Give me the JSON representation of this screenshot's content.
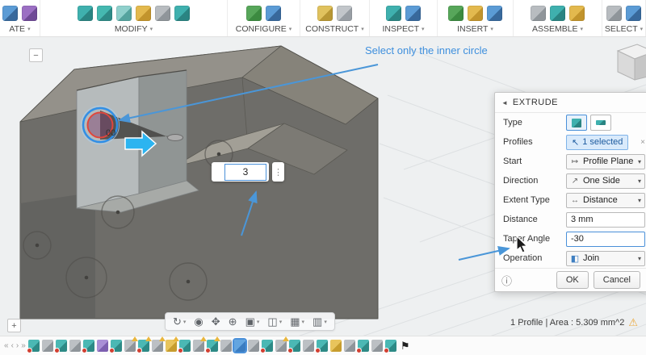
{
  "colors": {
    "accent": "#4a90d9",
    "annotation_blue": "#3e8fdd",
    "selection_blue_ring": "#2f8fe8",
    "selection_red_ring": "#e0463c",
    "warning_yellow": "#eba73a",
    "timeline_error_red": "#d23f31"
  },
  "toolbar": {
    "chevron": "▾",
    "groups": [
      {
        "id": "create",
        "label": "ATE",
        "icons": [
          {
            "name": "create-sketch-icon",
            "c1": "#5b9bd5",
            "c2": "#38699c"
          },
          {
            "name": "create-form-icon",
            "c1": "#9b6fc3",
            "c2": "#6f4a96"
          }
        ]
      },
      {
        "id": "modify",
        "label": "MODIFY",
        "icons": [
          {
            "name": "press-pull-icon",
            "c1": "#3fb0ae",
            "c2": "#2a8482"
          },
          {
            "name": "fillet-icon",
            "c1": "#45b8b0",
            "c2": "#2d8a86"
          },
          {
            "name": "shell-icon",
            "c1": "#8fd0cc",
            "c2": "#54a39e"
          },
          {
            "name": "combine-icon",
            "c1": "#e3b94e",
            "c2": "#c2942c"
          },
          {
            "name": "offset-face-icon",
            "c1": "#b8bcc0",
            "c2": "#8f959a"
          },
          {
            "name": "split-body-icon",
            "c1": "#3fb0ae",
            "c2": "#2a8482"
          }
        ]
      },
      {
        "id": "configure",
        "label": "CONFIGURE",
        "icons": [
          {
            "name": "configuration-table-icon",
            "c1": "#57a65a",
            "c2": "#3c8a40"
          },
          {
            "name": "variants-icon",
            "c1": "#5b9bd5",
            "c2": "#38699c"
          }
        ]
      },
      {
        "id": "construct",
        "label": "CONSTRUCT",
        "icons": [
          {
            "name": "offset-plane-icon",
            "c1": "#e0c25e",
            "c2": "#b89734"
          },
          {
            "name": "construction-axis-icon",
            "c1": "#c2c6ca",
            "c2": "#989ea4"
          }
        ]
      },
      {
        "id": "inspect",
        "label": "INSPECT",
        "icons": [
          {
            "name": "measure-icon",
            "c1": "#3fb0ae",
            "c2": "#2a8482"
          },
          {
            "name": "section-analysis-icon",
            "c1": "#5b9bd5",
            "c2": "#38699c"
          }
        ]
      },
      {
        "id": "insert",
        "label": "INSERT",
        "icons": [
          {
            "name": "insert-canvas-icon",
            "c1": "#57a65a",
            "c2": "#3c8a40"
          },
          {
            "name": "insert-mesh-icon",
            "c1": "#e3b94e",
            "c2": "#c2942c"
          },
          {
            "name": "insert-decal-icon",
            "c1": "#5b9bd5",
            "c2": "#38699c"
          }
        ]
      },
      {
        "id": "assemble",
        "label": "ASSEMBLE",
        "icons": [
          {
            "name": "new-component-icon",
            "c1": "#b8bcc0",
            "c2": "#8f959a"
          },
          {
            "name": "joint-icon",
            "c1": "#3fb0ae",
            "c2": "#2a8482"
          },
          {
            "name": "rigid-group-icon",
            "c1": "#e3b94e",
            "c2": "#c2942c"
          }
        ]
      },
      {
        "id": "select",
        "label": "SELECT",
        "icons": [
          {
            "name": "select-tool-icon",
            "c1": "#b8bcc0",
            "c2": "#8f959a"
          },
          {
            "name": "select-window-icon",
            "c1": "#5b9bd5",
            "c2": "#38699c"
          }
        ]
      }
    ]
  },
  "canvas": {
    "annotation": "Select only the inner circle",
    "dim_fragment": "00",
    "floating_input": {
      "value": "3",
      "grip": "⋮"
    },
    "collapse_button": "−",
    "add_button": "+"
  },
  "extrude_panel": {
    "collapse_icon": "◄",
    "title": "EXTRUDE",
    "rows": {
      "type": {
        "label": "Type"
      },
      "profiles": {
        "label": "Profiles",
        "cursor": "↖",
        "value": "1 selected",
        "clear": "×"
      },
      "start": {
        "label": "Start",
        "icon": "↦",
        "value": "Profile Plane",
        "chevron": "▾"
      },
      "direction": {
        "label": "Direction",
        "icon": "↗",
        "value": "One Side",
        "chevron": "▾"
      },
      "extent": {
        "label": "Extent Type",
        "icon": "↔",
        "value": "Distance",
        "chevron": "▾"
      },
      "distance": {
        "label": "Distance",
        "value": "3 mm"
      },
      "taper": {
        "label": "Taper Angle",
        "value": "-30"
      },
      "operation": {
        "label": "Operation",
        "icon": "◧",
        "value": "Join",
        "chevron": "▾"
      }
    },
    "info_icon": "ⓘ",
    "ok": "OK",
    "cancel": "Cancel"
  },
  "status": {
    "text": "1 Profile | Area : 5.309 mm^2",
    "warning": "⚠"
  },
  "navbar": {
    "chevron": "▾",
    "items": [
      {
        "name": "orbit-tool",
        "glyph": "↻",
        "chevron": true
      },
      {
        "name": "look-at-tool",
        "glyph": "◉",
        "chevron": false
      },
      {
        "name": "pan-tool",
        "glyph": "✥",
        "chevron": false
      },
      {
        "name": "zoom-tool",
        "glyph": "⊕",
        "chevron": false
      },
      {
        "name": "fit-tool",
        "glyph": "▣",
        "chevron": true
      },
      {
        "name": "display-settings",
        "glyph": "◫",
        "chevron": true
      },
      {
        "name": "grid-settings",
        "glyph": "▦",
        "chevron": true
      },
      {
        "name": "viewport-settings",
        "glyph": "▥",
        "chevron": true
      }
    ]
  },
  "timeline": {
    "playback": [
      "«",
      "‹",
      "›",
      "»"
    ],
    "flag": "⚑",
    "items": [
      {
        "kind": "sketch",
        "red": true
      },
      {
        "kind": "feature"
      },
      {
        "kind": "sketch",
        "red": true
      },
      {
        "kind": "feature"
      },
      {
        "kind": "sketch",
        "red": true
      },
      {
        "kind": "purple"
      },
      {
        "kind": "sketch",
        "red": true
      },
      {
        "kind": "feature",
        "warn": true
      },
      {
        "kind": "sketch",
        "red": true,
        "warn": true
      },
      {
        "kind": "feature",
        "warn": true
      },
      {
        "kind": "yellow",
        "warn": true
      },
      {
        "kind": "sketch",
        "red": true
      },
      {
        "kind": "feature",
        "warn": true
      },
      {
        "kind": "sketch",
        "red": true,
        "warn": true
      },
      {
        "kind": "feature"
      },
      {
        "kind": "blue",
        "selected": true
      },
      {
        "kind": "feature"
      },
      {
        "kind": "sketch",
        "red": true
      },
      {
        "kind": "feature",
        "warn": true
      },
      {
        "kind": "sketch",
        "red": true
      },
      {
        "kind": "feature"
      },
      {
        "kind": "sketch",
        "red": true
      },
      {
        "kind": "yellow"
      },
      {
        "kind": "feature"
      },
      {
        "kind": "sketch",
        "red": true
      },
      {
        "kind": "feature"
      },
      {
        "kind": "sketch",
        "red": true
      }
    ]
  }
}
